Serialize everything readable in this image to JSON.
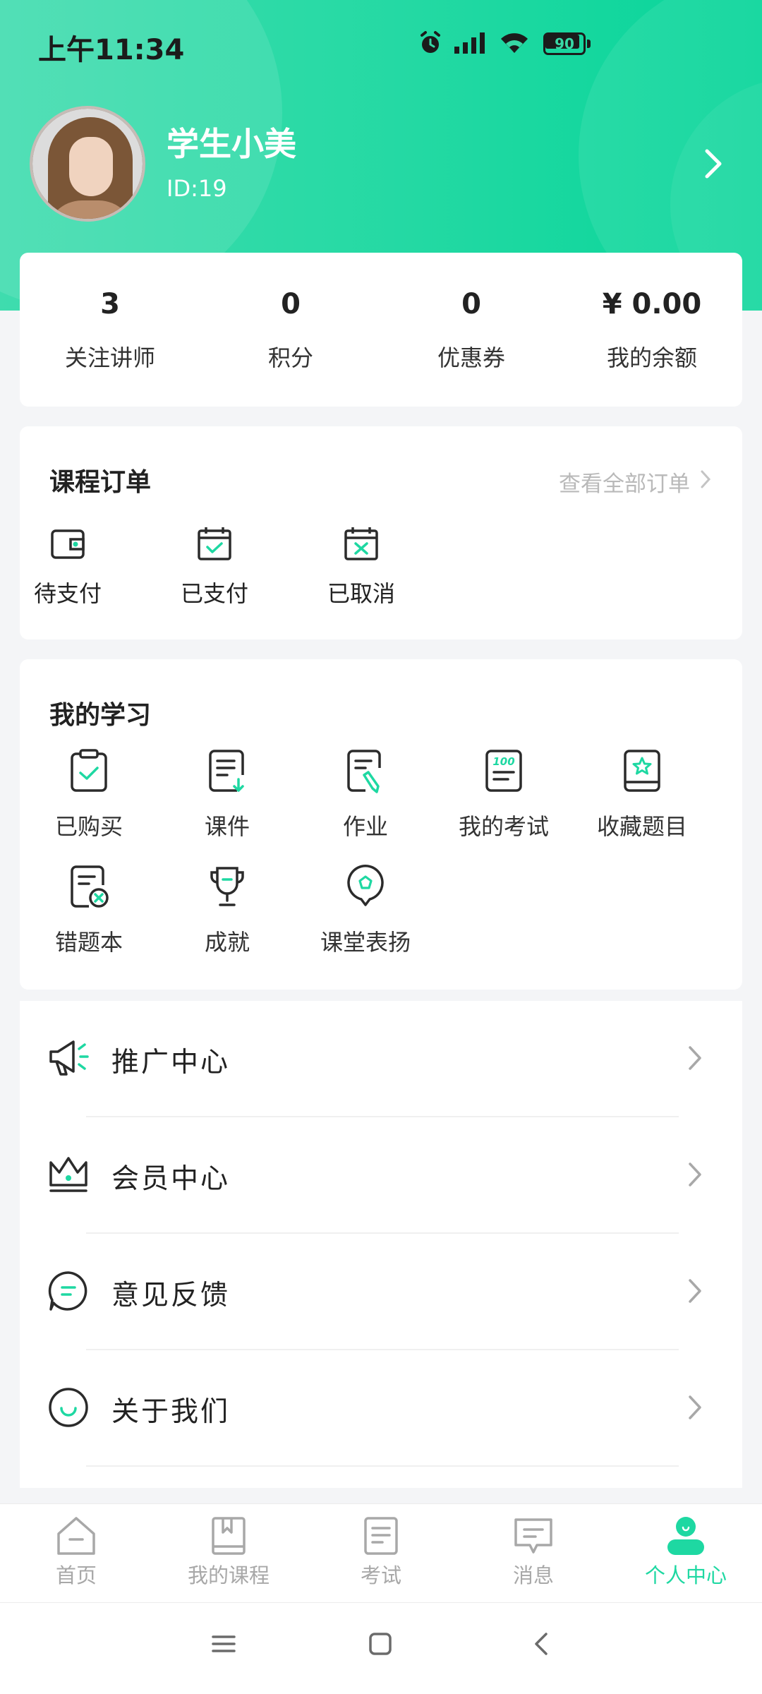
{
  "status_bar": {
    "time": "上午11:34",
    "battery_level": "90",
    "icons": [
      "alarm-icon",
      "signal-icon",
      "wifi-icon",
      "battery-icon"
    ]
  },
  "colors": {
    "accent": "#1ed8a2",
    "header_gradient_start": "#3fdcae",
    "header_gradient_end": "#07d59a",
    "text_primary": "#222222",
    "text_muted": "#b9b9b9"
  },
  "profile": {
    "name": "学生小美",
    "id": "ID:19"
  },
  "stats": [
    {
      "value": "3",
      "label": "关注讲师"
    },
    {
      "value": "0",
      "label": "积分"
    },
    {
      "value": "0",
      "label": "优惠券"
    },
    {
      "value": "¥ 0.00",
      "label": "我的余额"
    }
  ],
  "orders": {
    "title": "课程订单",
    "see_all": "查看全部订单",
    "items": [
      {
        "label": "待支付",
        "icon": "wallet-icon"
      },
      {
        "label": "已支付",
        "icon": "calendar-check-icon"
      },
      {
        "label": "已取消",
        "icon": "calendar-cancel-icon"
      }
    ]
  },
  "study": {
    "title": "我的学习",
    "items": [
      {
        "label": "已购买",
        "icon": "clipboard-check-icon"
      },
      {
        "label": "课件",
        "icon": "document-download-icon"
      },
      {
        "label": "作业",
        "icon": "homework-pen-icon"
      },
      {
        "label": "我的考试",
        "icon": "exam-score-icon"
      },
      {
        "label": "收藏题目",
        "icon": "star-book-icon"
      },
      {
        "label": "错题本",
        "icon": "wrong-answers-icon"
      },
      {
        "label": "成就",
        "icon": "trophy-icon"
      },
      {
        "label": "课堂表扬",
        "icon": "praise-badge-icon"
      }
    ]
  },
  "menu": [
    {
      "label": "推广中心",
      "icon": "megaphone-icon"
    },
    {
      "label": "会员中心",
      "icon": "crown-icon"
    },
    {
      "label": "意见反馈",
      "icon": "feedback-bubble-icon"
    },
    {
      "label": "关于我们",
      "icon": "smile-icon"
    }
  ],
  "tabs": [
    {
      "label": "首页",
      "icon": "home-icon",
      "active": false
    },
    {
      "label": "我的课程",
      "icon": "book-icon",
      "active": false
    },
    {
      "label": "考试",
      "icon": "exam-paper-icon",
      "active": false
    },
    {
      "label": "消息",
      "icon": "message-icon",
      "active": false
    },
    {
      "label": "个人中心",
      "icon": "user-icon",
      "active": true
    }
  ],
  "system_nav": [
    "menu-icon",
    "home-square-icon",
    "back-icon"
  ]
}
